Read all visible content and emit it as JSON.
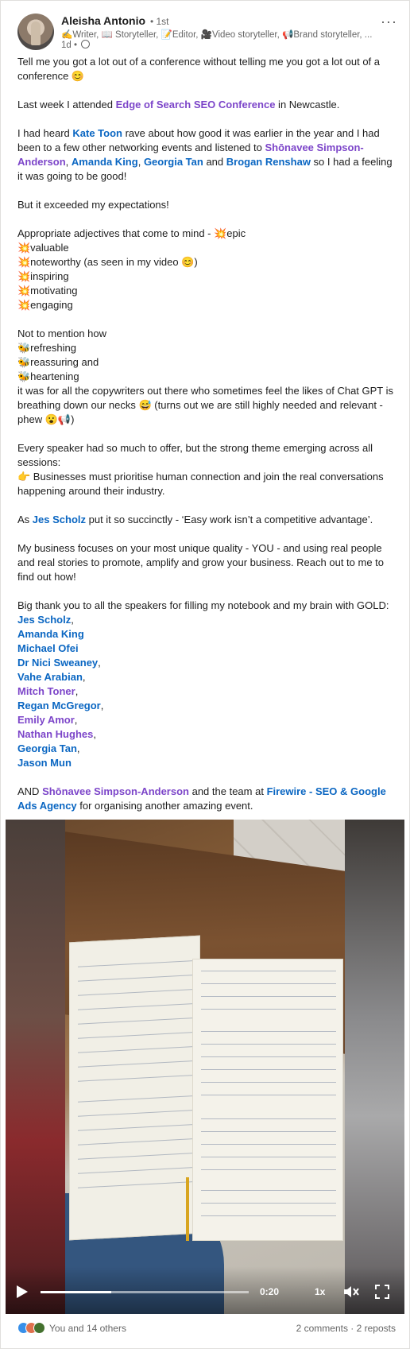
{
  "post": {
    "author": "Aleisha Antonio",
    "degree": "• 1st",
    "headline": "✍️Writer, 📖 Storyteller, 📝Editor, 🎥Video storyteller, 📢Brand storyteller, ...",
    "time": "1d •",
    "more_label": "···"
  },
  "body": {
    "p1": "Tell me you got a lot out of a conference without telling me you got a lot out of a conference 😊",
    "p2_a": "Last week I attended ",
    "p2_link": "Edge of Search SEO Conference",
    "p2_b": " in Newcastle.",
    "p3_a": "I had heard ",
    "p3_kate": "Kate Toon",
    "p3_b": " rave about how good it was earlier in the year and I had been to a few other networking events and listened to ",
    "p3_shon": "Shōnavee Simpson-Anderson",
    "p3_c": ", ",
    "p3_amanda": "Amanda King",
    "p3_d": ", ",
    "p3_georgia": "Georgia Tan",
    "p3_e": " and ",
    "p3_brogan": "Brogan Renshaw",
    "p3_f": " so I had a feeling it was going to be good!",
    "p4": "But it exceeded my expectations!",
    "adj_intro": "Appropriate adjectives that come to mind - 💥epic",
    "adj": [
      "💥valuable",
      "💥noteworthy (as seen in my video 😊)",
      "💥inspiring",
      "💥motivating",
      "💥engaging"
    ],
    "mention_intro": "Not to mention how",
    "mention_items": [
      "🐝refreshing",
      "🐝reassuring and",
      "🐝heartening"
    ],
    "mention_tail": "it was for all the copywriters out there who sometimes feel the likes of Chat GPT is breathing down our necks 😅 (turns out we are still highly needed and relevant - phew 😮📢)",
    "speaker_a": "Every speaker had so much to offer, but the strong theme emerging across all sessions:",
    "speaker_b": "👉 Businesses must prioritise human connection and join the real conversations happening around their industry.",
    "jes_a": "As ",
    "jes_link": "Jes Scholz",
    "jes_b": " put it so succinctly - ‘Easy work isn’t a competitive advantage’.",
    "business": "My business focuses on your most unique quality - YOU - and using real people and real stories to promote, amplify and grow your business. Reach out to me to find out how!",
    "thanks": "Big thank you to all the speakers for filling my notebook and my brain with GOLD:",
    "speakers": [
      {
        "name": "Jes Scholz",
        "sep": ","
      },
      {
        "name": "Amanda King",
        "sep": ""
      },
      {
        "name": "Michael Ofei",
        "sep": ""
      },
      {
        "name": "Dr Nici Sweaney",
        "sep": ","
      },
      {
        "name": "Vahe Arabian",
        "sep": ","
      },
      {
        "name": "Mitch Toner",
        "sep": ","
      },
      {
        "name": "Regan McGregor",
        "sep": ","
      },
      {
        "name": "Emily Amor",
        "sep": ","
      },
      {
        "name": "Nathan Hughes",
        "sep": ","
      },
      {
        "name": "Georgia Tan",
        "sep": ","
      },
      {
        "name": "Jason Mun",
        "sep": ""
      }
    ],
    "and_a": "AND ",
    "and_shon": "Shōnavee Simpson-Anderson",
    "and_b": " and the team at ",
    "and_firewire": "Firewire - SEO & Google Ads Agency",
    "and_c": " for organising another amazing event."
  },
  "video": {
    "time": "0:20",
    "speed": "1x",
    "progress": 0.34
  },
  "footer": {
    "reactions_text": "You and 14 others",
    "counts": "2 comments · 2 reposts"
  },
  "colors": {
    "link_blue": "#0a66c2",
    "link_purple": "#7c45c9"
  }
}
